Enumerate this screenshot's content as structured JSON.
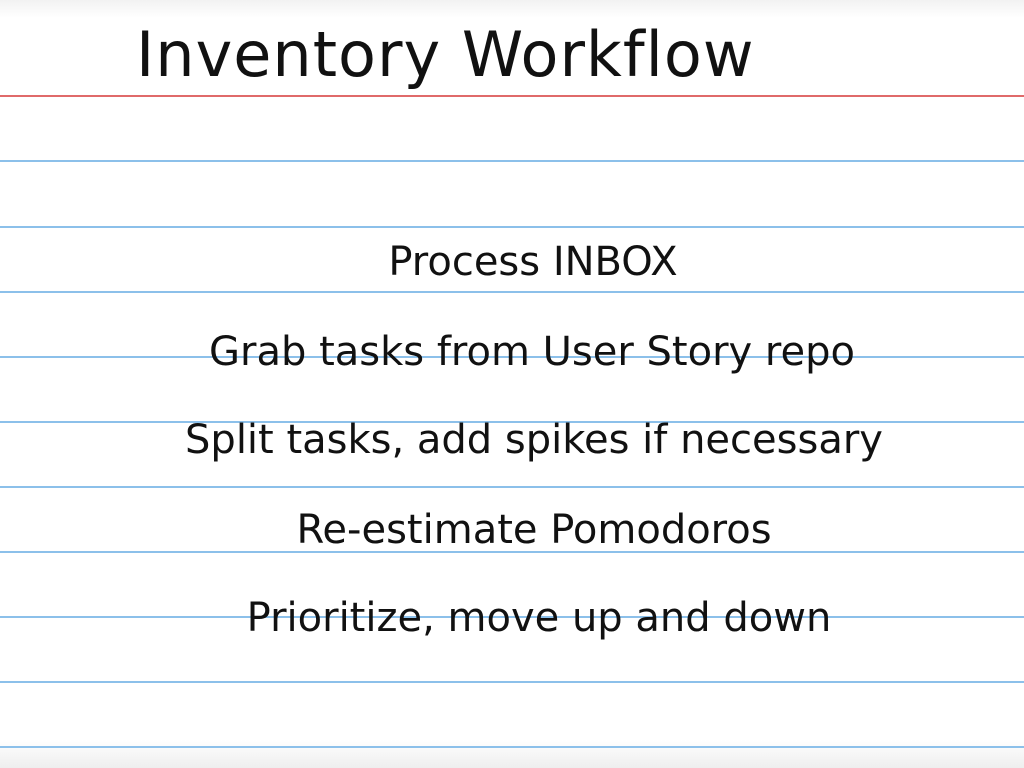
{
  "card": {
    "title": "Inventory Workflow",
    "items": [
      "Process INBOX",
      "Grab tasks from User Story repo",
      "Split tasks, add spikes if necessary",
      "Re-estimate Pomodoros",
      "Prioritize, move up and down"
    ]
  },
  "colors": {
    "margin_line": "#e06a6a",
    "ruled_lines": "#8cc0ea",
    "ink": "#111111",
    "paper": "#ffffff"
  }
}
